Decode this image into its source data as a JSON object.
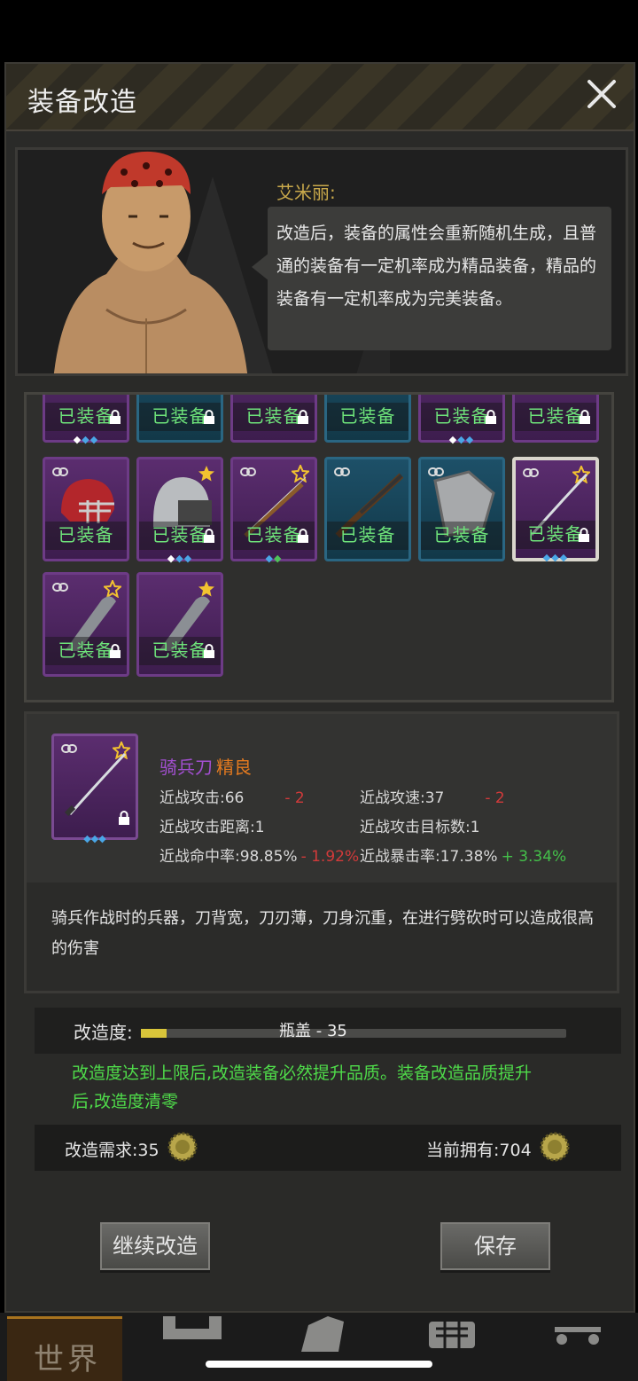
{
  "dialog": {
    "title": "装备改造",
    "npc_name": "艾米丽:",
    "speech": "改造后，装备的属性会重新随机生成，且普通的装备有一定机率成为精品装备，精品的装备有一定机率成为完美装备。"
  },
  "equipment": {
    "equipped_label": "已装备",
    "row_top": [
      {
        "color": "purple"
      },
      {
        "color": "blue"
      },
      {
        "color": "purple"
      },
      {
        "color": "blue"
      },
      {
        "color": "purple"
      },
      {
        "color": "purple"
      }
    ],
    "row_middle": [
      {
        "item": "red football helmet",
        "color": "purple",
        "star": false
      },
      {
        "item": "police helmet",
        "color": "purple",
        "star": true
      },
      {
        "item": "bow",
        "color": "purple",
        "star": true
      },
      {
        "item": "shotgun",
        "color": "blue",
        "star": false
      },
      {
        "item": "shield",
        "color": "blue",
        "star": false
      },
      {
        "item": "cavalry saber",
        "color": "purple",
        "star": true,
        "selected": true
      }
    ],
    "row_bottom": [
      {
        "item": "machete",
        "color": "purple",
        "star": true
      },
      {
        "item": "machete",
        "color": "purple",
        "star": true
      }
    ]
  },
  "detail": {
    "name": "骑兵刀",
    "quality": "精良",
    "stats": {
      "melee_attack": "近战攻击:66",
      "melee_attack_delta": "- 2",
      "melee_speed": "近战攻速:37",
      "melee_speed_delta": "- 2",
      "melee_range": "近战攻击距离:1",
      "melee_targets": "近战攻击目标数:1",
      "melee_hit": "近战命中率:98.85%",
      "melee_hit_delta": "- 1.92%",
      "melee_crit": "近战暴击率:17.38%",
      "melee_crit_delta": "+ 3.34%"
    },
    "description": "骑兵作战时的兵器，刀背宽，刀刃薄，刀身沉重，在进行劈砍时可以造成很高的伤害"
  },
  "refine": {
    "label": "改造度:",
    "progress_text": "瓶盖 - 35",
    "progress_fraction": 0.06,
    "notice": "改造度达到上限后,改造装备必然提升品质。装备改造品质提升后,改造度清零",
    "cost": "改造需求:35",
    "owned": "当前拥有:704"
  },
  "buttons": {
    "continue": "继续改造",
    "save": "保存"
  },
  "nav": {
    "world": "世界"
  },
  "colors": {
    "accent_gold": "#c9a94b",
    "equipped_green": "#6ee37a",
    "purple_quality": "#a24fd0",
    "quality_orange": "#e47a1f",
    "negative_red": "#d23a3a",
    "positive_green": "#44c04a",
    "notice_green": "#4fdc4a"
  }
}
